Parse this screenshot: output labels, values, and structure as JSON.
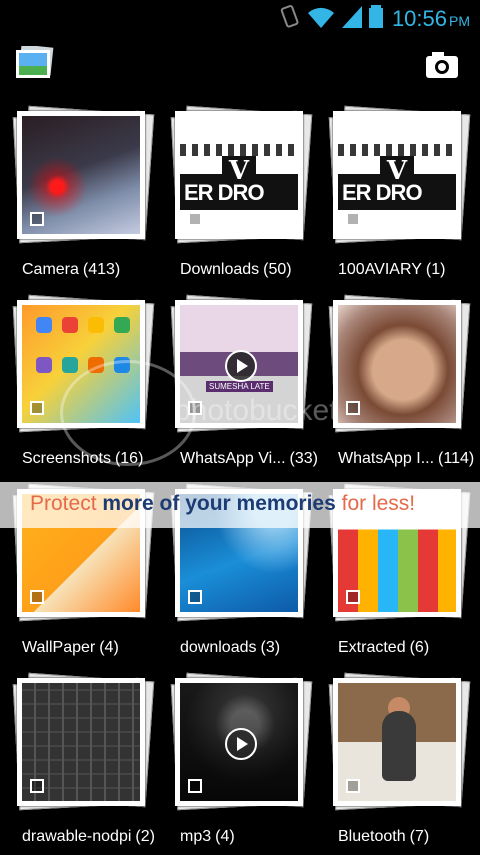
{
  "status_bar": {
    "time": "10:56",
    "ampm": "PM",
    "icons": [
      "vibrate-icon",
      "wifi-icon",
      "signal-icon",
      "battery-icon"
    ],
    "accent_color": "#33b5e5"
  },
  "action_bar": {
    "app_icon": "gallery-icon",
    "camera_icon": "camera-icon"
  },
  "albums": [
    {
      "name": "Camera",
      "count": "(413)",
      "thumb": "t-camera",
      "video": false
    },
    {
      "name": "Downloads",
      "count": "(50)",
      "thumb": "t-dl",
      "video": false
    },
    {
      "name": "100AVIARY",
      "count": "(1)",
      "thumb": "t-dl",
      "video": false
    },
    {
      "name": "Screenshots",
      "count": "(16)",
      "thumb": "t-ss",
      "video": false
    },
    {
      "name": "WhatsApp Vi...",
      "count": "(33)",
      "thumb": "t-wav",
      "video": true
    },
    {
      "name": "WhatsApp I...",
      "count": "(114)",
      "thumb": "t-wai",
      "video": false
    },
    {
      "name": "WallPaper",
      "count": "(4)",
      "thumb": "t-wp",
      "video": false
    },
    {
      "name": "downloads",
      "count": "(3)",
      "thumb": "t-dl2",
      "video": false
    },
    {
      "name": "Extracted",
      "count": "(6)",
      "thumb": "t-ex",
      "video": false
    },
    {
      "name": "drawable-nodpi",
      "count": "(2)",
      "thumb": "t-dn",
      "video": false
    },
    {
      "name": "mp3",
      "count": "(4)",
      "thumb": "t-mp3",
      "video": true
    },
    {
      "name": "Bluetooth",
      "count": "(7)",
      "thumb": "t-bt",
      "video": false
    }
  ],
  "thumb_text": {
    "downloads_word": "ER DRO",
    "downloads_logo": "V",
    "whatsapp_caption": "SUMESHA LATE"
  },
  "watermark": {
    "text": "photobucket",
    "banner_pre": "Protect ",
    "banner_mid": "more of your memories",
    "banner_post": " for less!"
  }
}
